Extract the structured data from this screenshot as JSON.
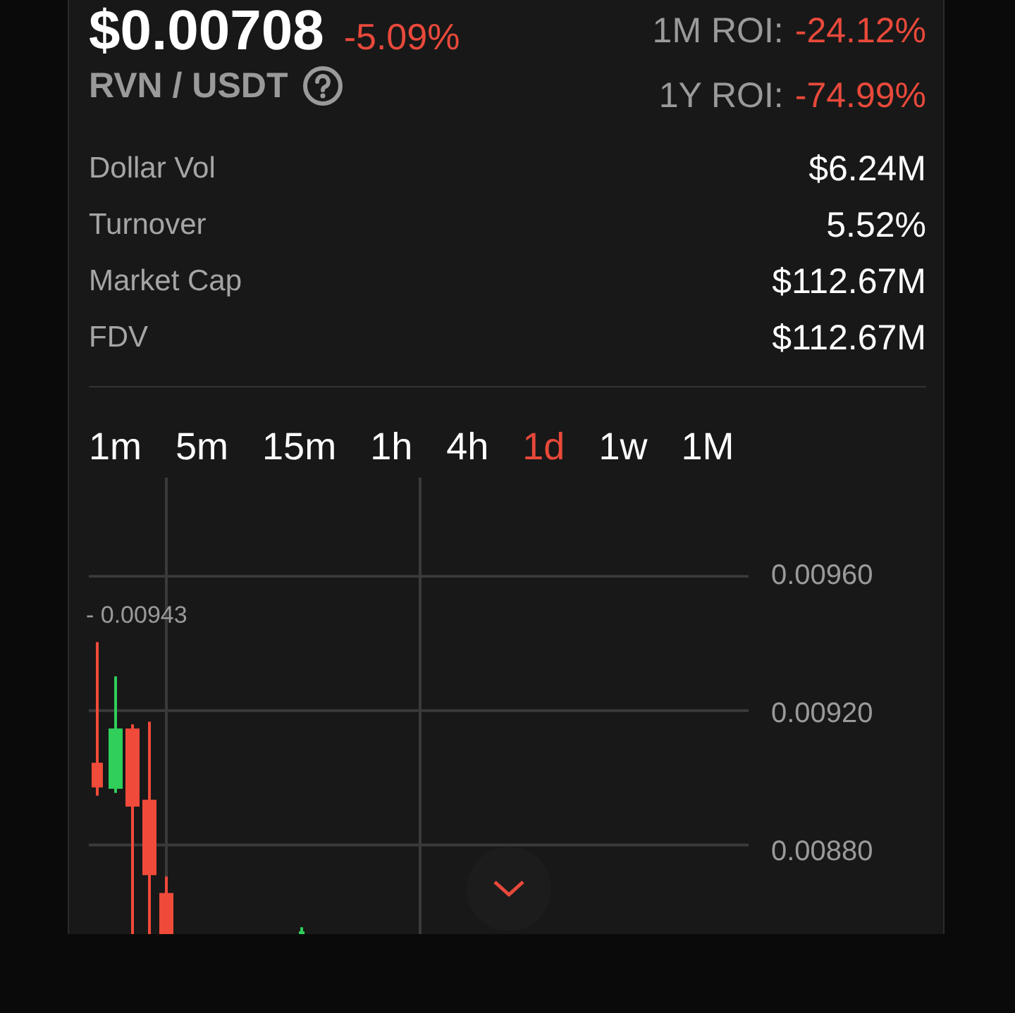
{
  "ticker": {
    "price": "$0.00708",
    "change": "-5.09%",
    "pair": "RVN / USDT"
  },
  "roi": [
    {
      "label": "1M ROI:",
      "value": "-24.12%"
    },
    {
      "label": "1Y ROI:",
      "value": "-74.99%"
    }
  ],
  "stats": [
    {
      "label": "Dollar Vol",
      "value": "$6.24M"
    },
    {
      "label": "Turnover",
      "value": "5.52%"
    },
    {
      "label": "Market Cap",
      "value": "$112.67M"
    },
    {
      "label": "FDV",
      "value": "$112.67M"
    }
  ],
  "timeframes": [
    {
      "label": "1m",
      "selected": false
    },
    {
      "label": "5m",
      "selected": false
    },
    {
      "label": "15m",
      "selected": false
    },
    {
      "label": "1h",
      "selected": false
    },
    {
      "label": "4h",
      "selected": false
    },
    {
      "label": "1d",
      "selected": true
    },
    {
      "label": "1w",
      "selected": false
    },
    {
      "label": "1M",
      "selected": false
    }
  ],
  "chart": {
    "y_axis": [
      "0.00960",
      "0.00920",
      "0.00880"
    ],
    "price_marker": "- 0.00943"
  }
}
